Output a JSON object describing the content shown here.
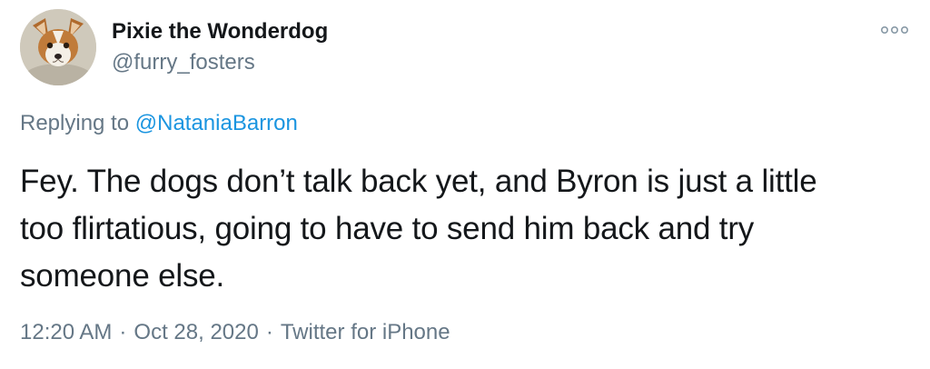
{
  "user": {
    "display_name": "Pixie the Wonderdog",
    "handle": "@furry_fosters",
    "avatar_icon": "dog-avatar"
  },
  "reply": {
    "prefix": "Replying to",
    "mention": "@NataniaBarron"
  },
  "tweet": {
    "text_lines": [
      "Fey. The dogs don’t talk back yet, and Byron is just a little",
      "too flirtatious, going to have to send him back and try",
      "someone else."
    ]
  },
  "meta": {
    "time": "12:20 AM",
    "separator": "·",
    "date": "Oct 28, 2020",
    "source": "Twitter for iPhone"
  },
  "icons": {
    "more": "more-options-icon"
  },
  "colors": {
    "text": "#14171a",
    "secondary": "#657786",
    "link": "#1b95e0"
  }
}
